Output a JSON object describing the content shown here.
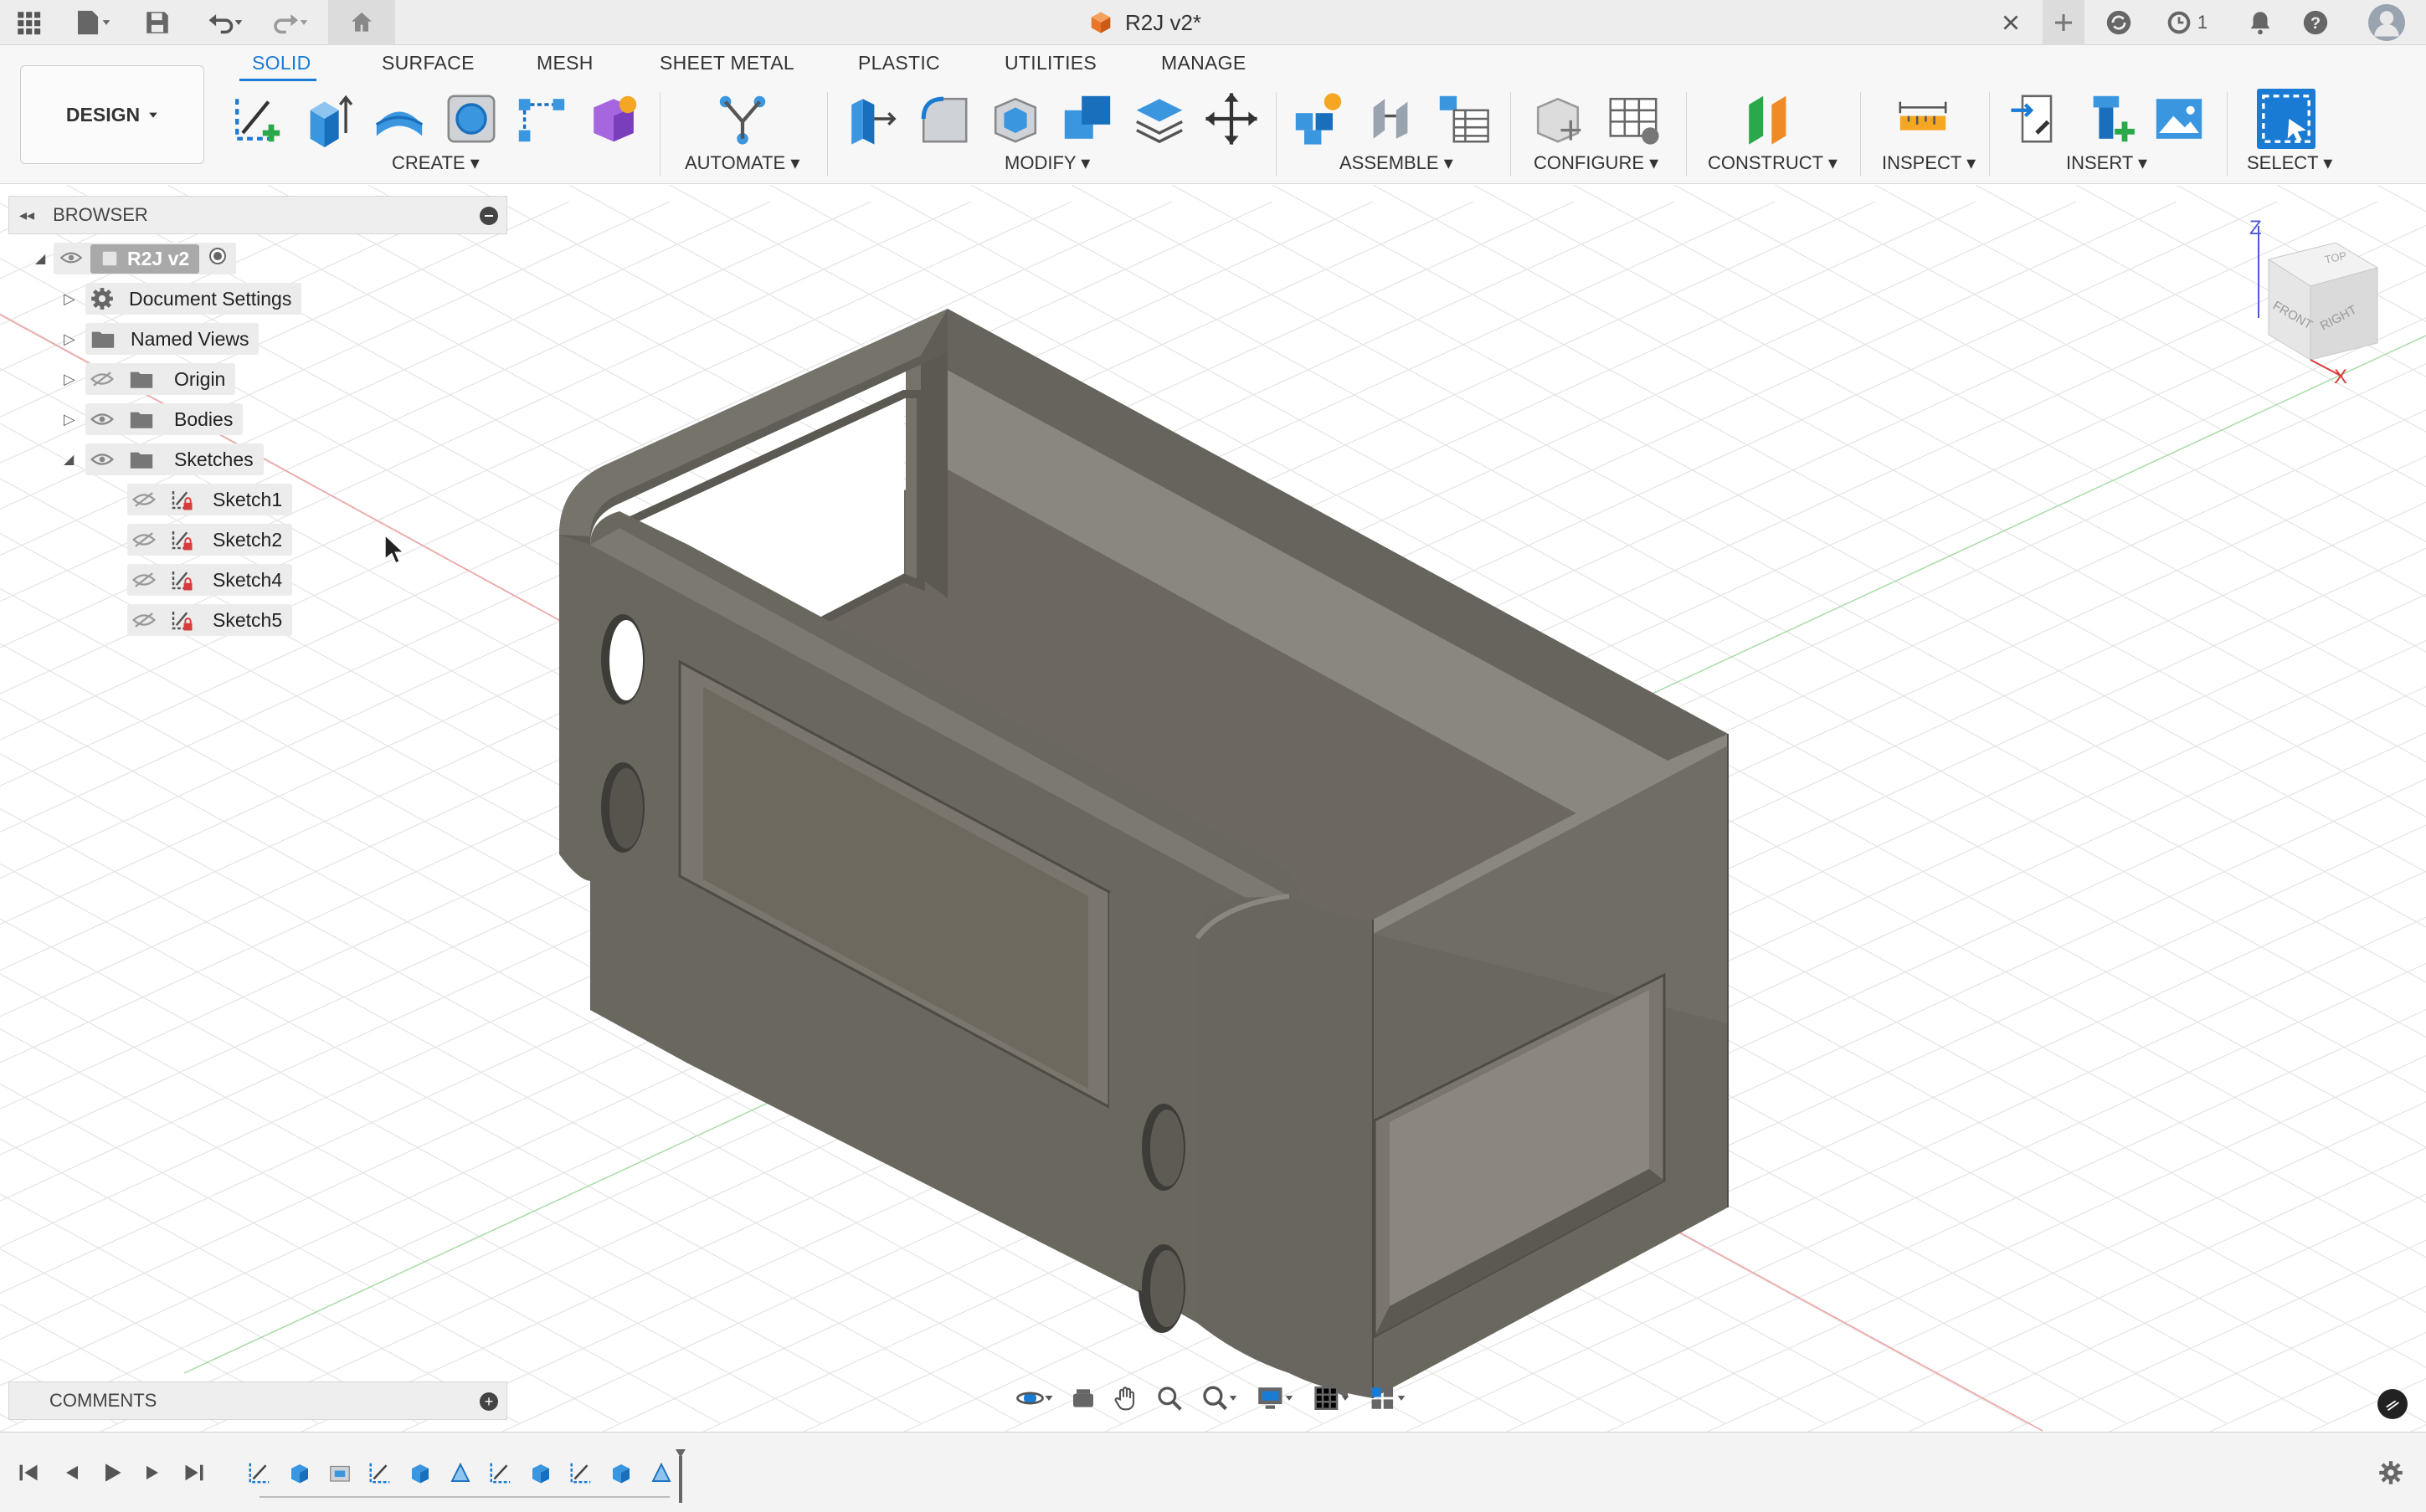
{
  "titlebar": {
    "document_title": "R2J v2*",
    "jobs_count": "1"
  },
  "toolbar": {
    "workspace_label": "DESIGN",
    "tabs": [
      {
        "label": "SOLID",
        "active": true
      },
      {
        "label": "SURFACE"
      },
      {
        "label": "MESH"
      },
      {
        "label": "SHEET METAL"
      },
      {
        "label": "PLASTIC"
      },
      {
        "label": "UTILITIES"
      },
      {
        "label": "MANAGE"
      }
    ],
    "groups": {
      "create": "CREATE",
      "automate": "AUTOMATE",
      "modify": "MODIFY",
      "assemble": "ASSEMBLE",
      "configure": "CONFIGURE",
      "construct": "CONSTRUCT",
      "inspect": "INSPECT",
      "insert": "INSERT",
      "select": "SELECT"
    },
    "accent_color": "#1a7bd4"
  },
  "browser": {
    "title": "BROWSER",
    "root": "R2J v2",
    "items": [
      {
        "label": "Document Settings",
        "icon": "gear-icon"
      },
      {
        "label": "Named Views",
        "icon": "folder-icon"
      },
      {
        "label": "Origin",
        "icon": "folder-icon",
        "visible": false
      },
      {
        "label": "Bodies",
        "icon": "folder-icon",
        "visible": true
      },
      {
        "label": "Sketches",
        "icon": "folder-icon",
        "visible": true,
        "expanded": true
      }
    ],
    "sketches": [
      "Sketch1",
      "Sketch2",
      "Sketch4",
      "Sketch5"
    ]
  },
  "comments": {
    "title": "COMMENTS"
  },
  "viewcube": {
    "top": "TOP",
    "front": "FRONT",
    "right": "RIGHT",
    "axis_z": "Z",
    "axis_x": "X"
  },
  "colors": {
    "model_body": "#6e6a62",
    "x_axis": "#e04040",
    "y_axis": "#3cb04a",
    "grid": "#e2e2e2"
  }
}
